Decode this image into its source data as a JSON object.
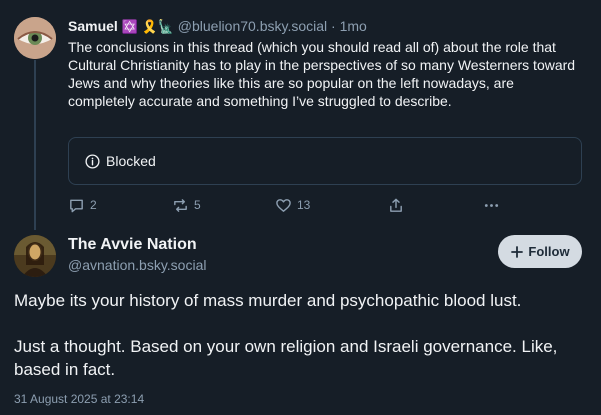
{
  "reply": {
    "author_name": "Samuel",
    "author_emoji": "✡️ 🎗️🗽",
    "handle": "@bluelion70.bsky.social",
    "separator": "·",
    "time": "1mo",
    "text": "The conclusions in this thread (which you should read all of) about the role that Cultural Christianity has to play in the perspectives of so many Westerners toward Jews and why theories like this are so popular on the left nowadays, are completely accurate and something I’ve struggled to describe.",
    "blocked_label": "Blocked",
    "actions": {
      "replies": "2",
      "reposts": "5",
      "likes": "13"
    }
  },
  "post": {
    "author_name": "The Avvie Nation",
    "handle": "@avnation.bsky.social",
    "follow_label": "Follow",
    "paragraphs": [
      "Maybe its your history of mass murder and psychopathic blood lust.",
      "Just a thought. Based on your own religion and Israeli governance. Like, based in fact."
    ],
    "date": "31 August 2025 at 23:14"
  },
  "colors": {
    "background": "#161e27",
    "muted_text": "#8d9fb1",
    "border": "#2e4052",
    "follow_button_bg": "#d4dbe2"
  },
  "icons": [
    "info-icon",
    "reply-icon",
    "repost-icon",
    "like-icon",
    "share-icon",
    "more-icon",
    "plus-icon"
  ]
}
